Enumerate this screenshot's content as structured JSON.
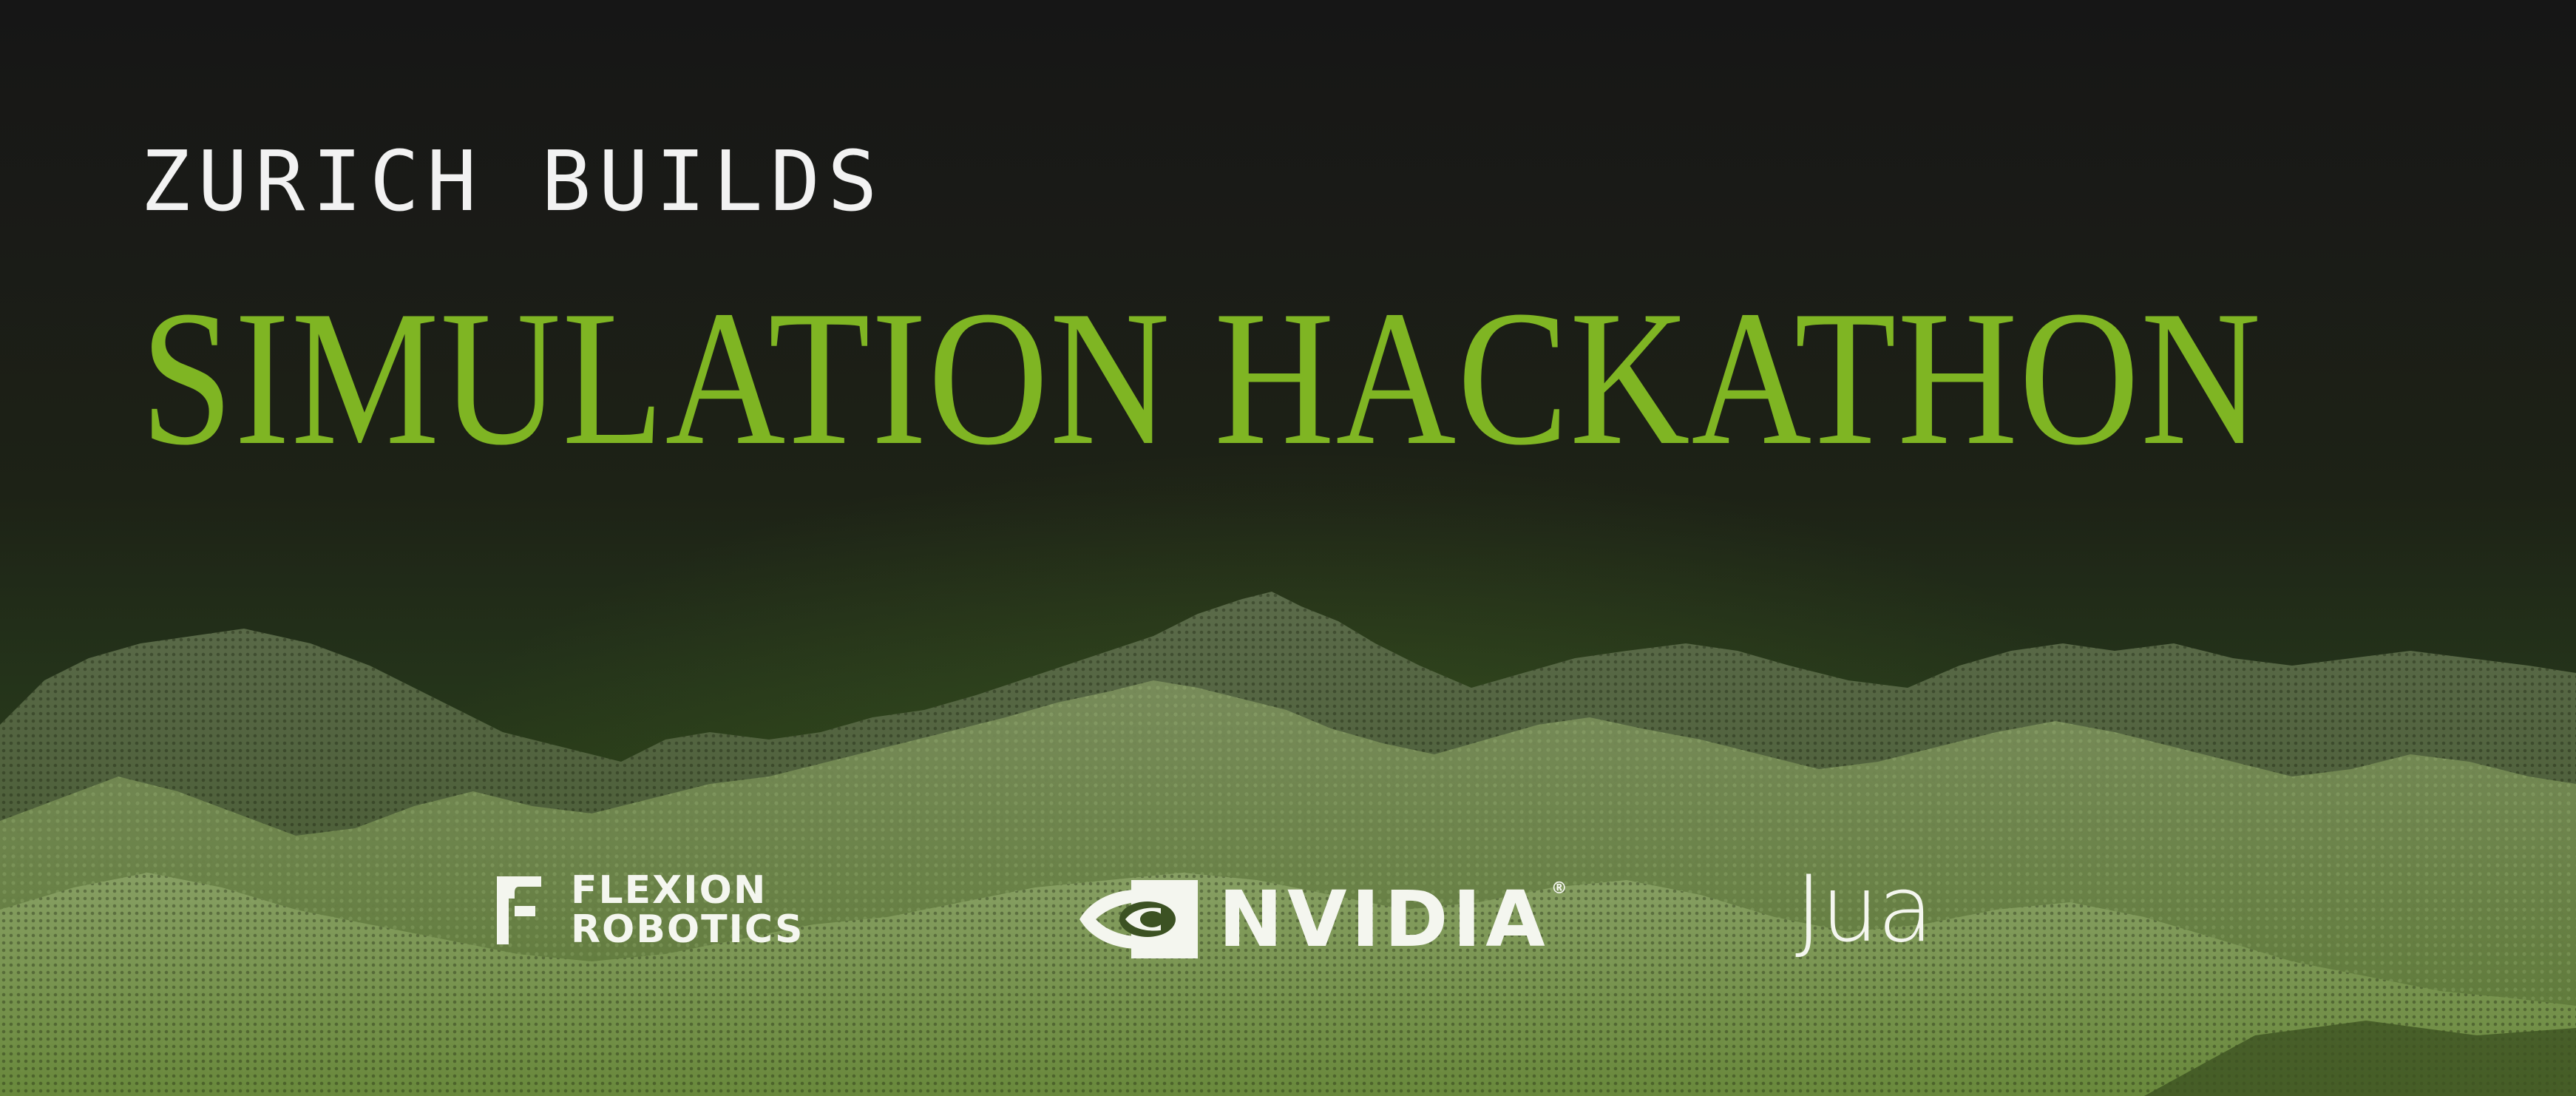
{
  "banner": {
    "kicker": "ZURICH BUILDS",
    "headline": "SIMULATION HACKATHON"
  },
  "sponsors": {
    "flexion_line1": "FLEXION",
    "flexion_line2": "ROBOTICS",
    "nvidia": "NVIDIA",
    "jua": "Jua"
  },
  "colors": {
    "background": "#151515",
    "headline": "#7fb523",
    "kicker": "#f2f2f2",
    "mountains": "#6f8e46",
    "logos": "#f4f6ef"
  },
  "icons": [
    "flexion-f-logo-icon",
    "nvidia-eye-logo-icon"
  ]
}
